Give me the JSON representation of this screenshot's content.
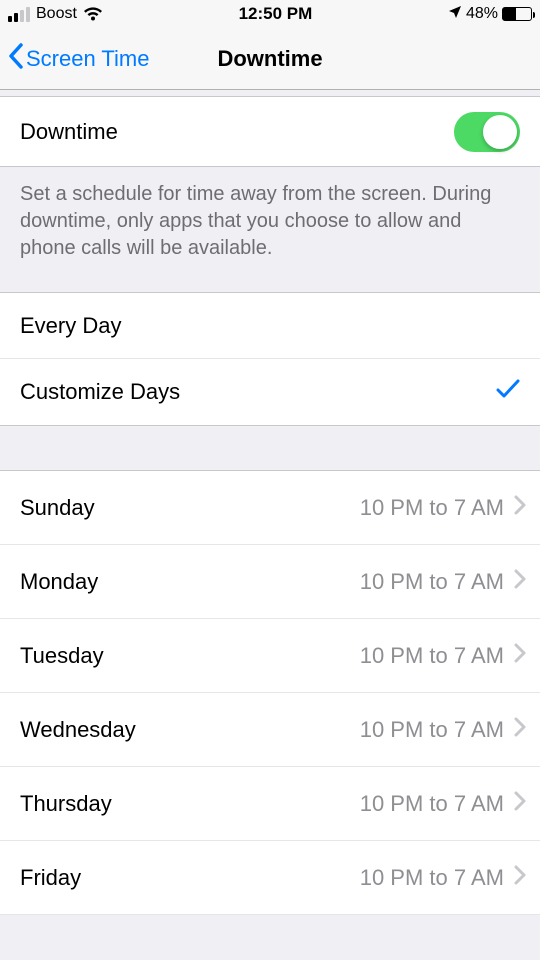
{
  "status": {
    "carrier": "Boost",
    "time": "12:50 PM",
    "battery_pct": "48%"
  },
  "nav": {
    "back_label": "Screen Time",
    "title": "Downtime"
  },
  "downtime_toggle": {
    "label": "Downtime",
    "on": true
  },
  "description": "Set a schedule for time away from the screen. During downtime, only apps that you choose to allow and phone calls will be available.",
  "schedule_mode": {
    "every_day_label": "Every Day",
    "customize_label": "Customize Days",
    "selected": "customize"
  },
  "days": [
    {
      "name": "Sunday",
      "time": "10 PM to 7 AM"
    },
    {
      "name": "Monday",
      "time": "10 PM to 7 AM"
    },
    {
      "name": "Tuesday",
      "time": "10 PM to 7 AM"
    },
    {
      "name": "Wednesday",
      "time": "10 PM to 7 AM"
    },
    {
      "name": "Thursday",
      "time": "10 PM to 7 AM"
    },
    {
      "name": "Friday",
      "time": "10 PM to 7 AM"
    }
  ]
}
